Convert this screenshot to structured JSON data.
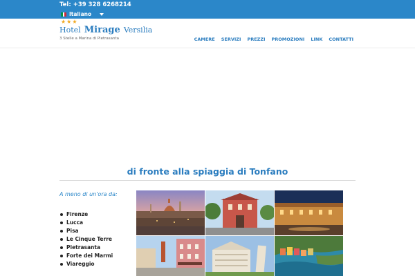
{
  "topbar": {
    "phone": "Tel: +39 328 6268214",
    "language": "Italiano",
    "flag_colors": [
      "#009246",
      "#ffffff",
      "#ce2b37"
    ]
  },
  "brand": {
    "stars": "★★★",
    "name_part1": "Hotel",
    "name_part2": "Mirage",
    "name_part3": "Versilia",
    "tagline": "3 Stelle a Marina di Pietrasanta"
  },
  "nav": {
    "items": [
      "CAMERE",
      "SERVIZI",
      "PREZZI",
      "PROMOZIONI",
      "LINK",
      "CONTATTI"
    ]
  },
  "main": {
    "headline": "di fronte alla spiaggia di Tonfano",
    "intro": "A meno di un'ora da:",
    "cities": [
      "Firenze",
      "Lucca",
      "Pisa",
      "Le Cinque Terre",
      "Pietrasanta",
      "Forte dei Marmi",
      "Viareggio"
    ]
  },
  "photos": [
    {
      "name": "photo-firenze",
      "icon": "florence-skyline"
    },
    {
      "name": "photo-lucca",
      "icon": "lucca-street"
    },
    {
      "name": "photo-lucca-night",
      "icon": "piazza-night"
    },
    {
      "name": "photo-pietrasanta",
      "icon": "town-street"
    },
    {
      "name": "photo-pisa",
      "icon": "pisa-cathedral"
    },
    {
      "name": "photo-cinque-terre",
      "icon": "coastal-village"
    }
  ],
  "colors": {
    "accent": "#2b87c9",
    "link": "#2b7dbf",
    "star": "#f0a71c"
  }
}
